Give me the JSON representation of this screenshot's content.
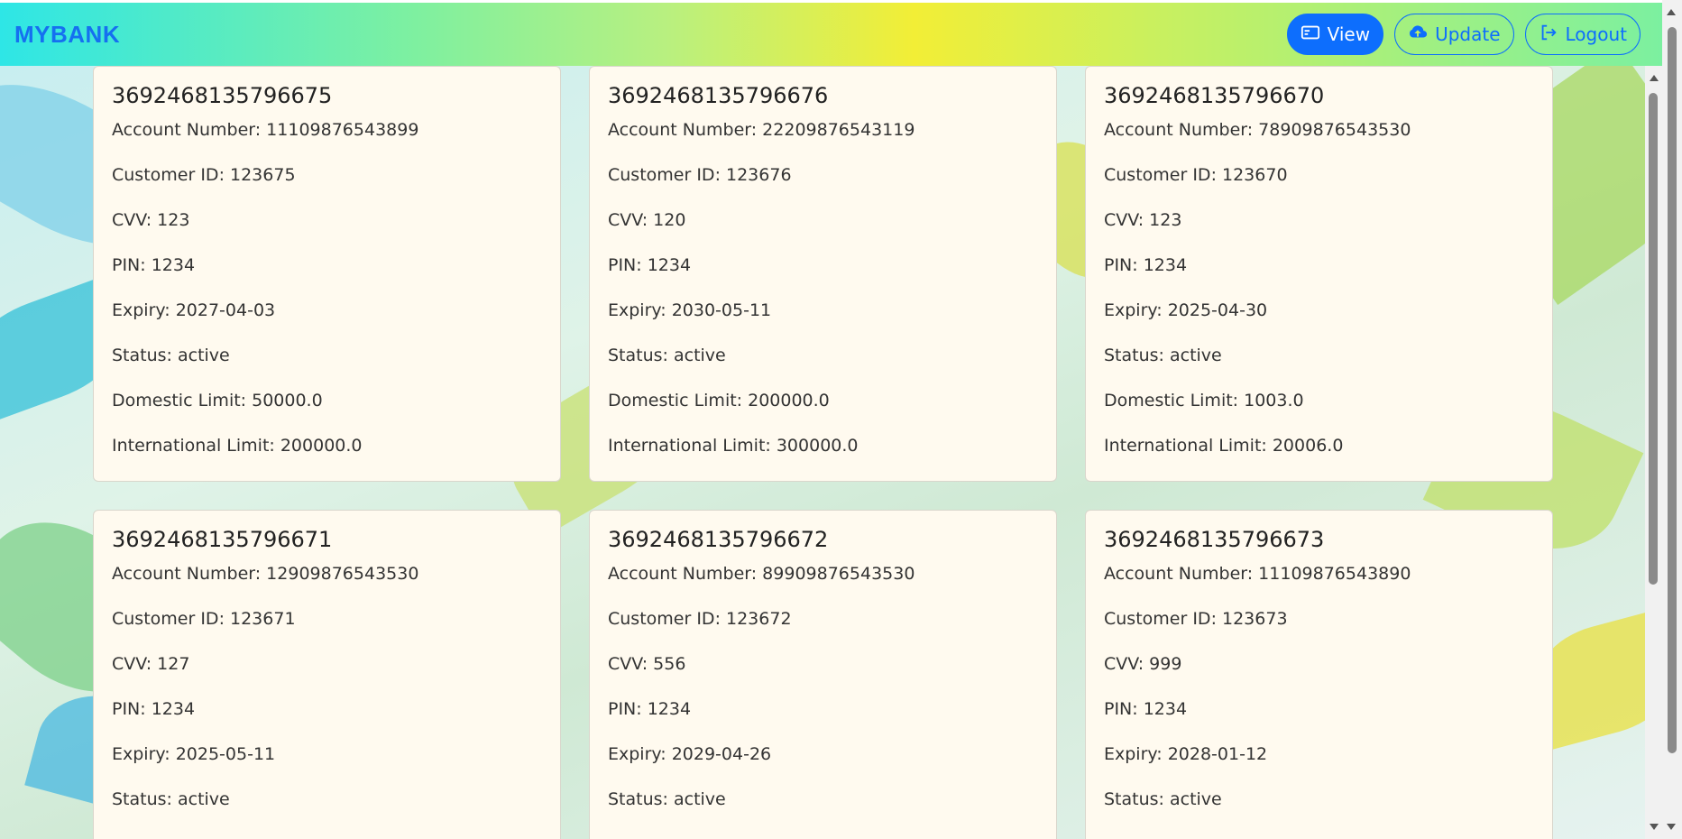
{
  "navbar": {
    "brand": "MYBANK",
    "buttons": [
      {
        "label": "View",
        "icon": "card-icon",
        "active": true
      },
      {
        "label": "Update",
        "icon": "cloud-upload-icon",
        "active": false
      },
      {
        "label": "Logout",
        "icon": "logout-icon",
        "active": false
      }
    ]
  },
  "colors": {
    "primary": "#0d6efd",
    "brand": "#1570f0",
    "card_bg": "#fffaef"
  },
  "cards": [
    {
      "title": "3692468135796675",
      "lines": [
        "Account Number: 11109876543899",
        "Customer ID: 123675",
        "CVV: 123",
        "PIN: 1234",
        "Expiry: 2027-04-03",
        "Status: active",
        "Domestic Limit: 50000.0",
        "International Limit: 200000.0"
      ]
    },
    {
      "title": "3692468135796676",
      "lines": [
        "Account Number: 22209876543119",
        "Customer ID: 123676",
        "CVV: 120",
        "PIN: 1234",
        "Expiry: 2030-05-11",
        "Status: active",
        "Domestic Limit: 200000.0",
        "International Limit: 300000.0"
      ]
    },
    {
      "title": "3692468135796670",
      "lines": [
        "Account Number: 78909876543530",
        "Customer ID: 123670",
        "CVV: 123",
        "PIN: 1234",
        "Expiry: 2025-04-30",
        "Status: active",
        "Domestic Limit: 1003.0",
        "International Limit: 20006.0"
      ]
    },
    {
      "title": "3692468135796671",
      "lines": [
        "Account Number: 12909876543530",
        "Customer ID: 123671",
        "CVV: 127",
        "PIN: 1234",
        "Expiry: 2025-05-11",
        "Status: active"
      ]
    },
    {
      "title": "3692468135796672",
      "lines": [
        "Account Number: 89909876543530",
        "Customer ID: 123672",
        "CVV: 556",
        "PIN: 1234",
        "Expiry: 2029-04-26",
        "Status: active"
      ]
    },
    {
      "title": "3692468135796673",
      "lines": [
        "Account Number: 11109876543890",
        "Customer ID: 123673",
        "CVV: 999",
        "PIN: 1234",
        "Expiry: 2028-01-12",
        "Status: active"
      ]
    }
  ]
}
